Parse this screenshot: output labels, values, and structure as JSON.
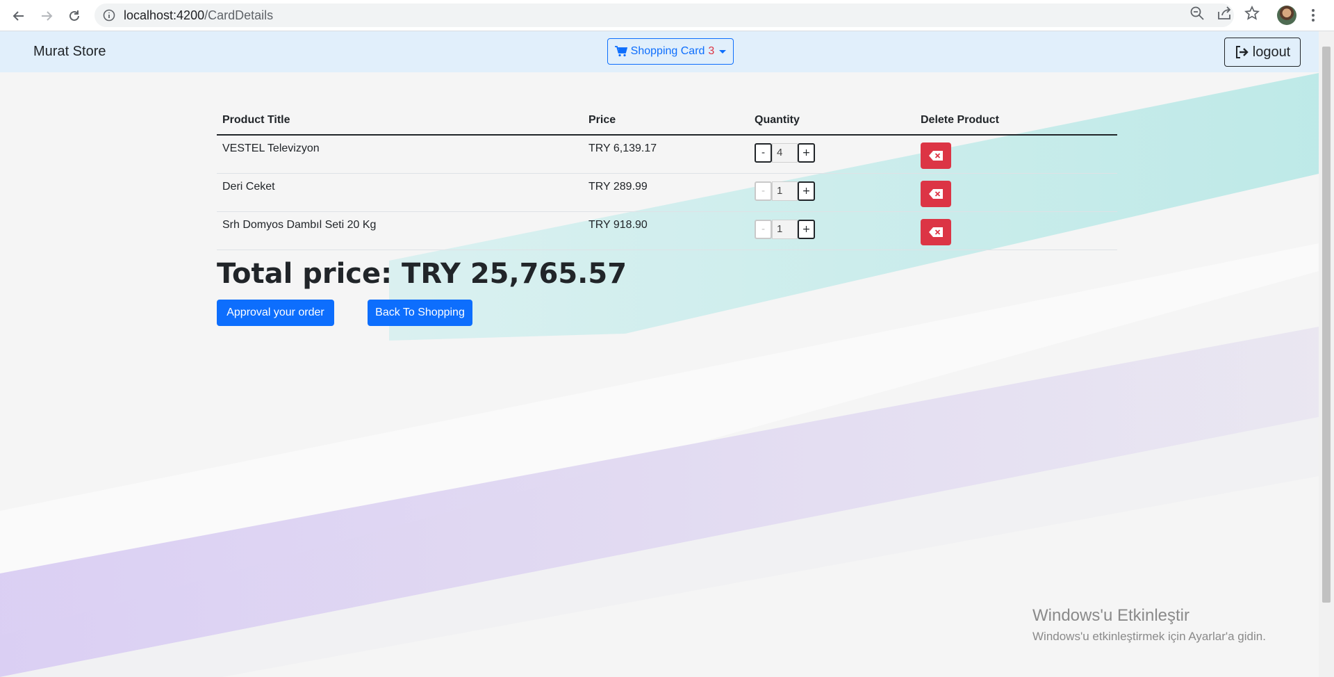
{
  "browser": {
    "url_host": "localhost:4200",
    "url_path": "/CardDetails"
  },
  "navbar": {
    "brand": "Murat Store",
    "cart_label": "Shopping Card",
    "cart_count": "3",
    "logout_label": "logout"
  },
  "table": {
    "headers": [
      "Product Title",
      "Price",
      "Quantity",
      "Delete Product"
    ],
    "rows": [
      {
        "title": "VESTEL Televizyon",
        "price": "TRY 6,139.17",
        "quantity": "4"
      },
      {
        "title": "Deri Ceket",
        "price": "TRY 289.99",
        "quantity": "1"
      },
      {
        "title": "Srh Domyos Dambıl Seti 20 Kg",
        "price": "TRY 918.90",
        "quantity": "1"
      }
    ],
    "minus_label": "-",
    "plus_label": "+"
  },
  "total": "Total price: TRY 25,765.57",
  "buttons": {
    "approve": "Approval your order",
    "back": "Back To Shopping"
  },
  "watermark": {
    "title": "Windows'u Etkinleştir",
    "subtitle": "Windows'u etkinleştirmek için Ayarlar'a gidin."
  },
  "colors": {
    "navbar_bg": "#e1effb",
    "primary": "#0d6efd",
    "danger": "#dc3545"
  },
  "icons": [
    "back-arrow-icon",
    "forward-arrow-icon",
    "reload-icon",
    "info-icon",
    "zoom-icon",
    "share-icon",
    "star-icon",
    "cart-icon",
    "logout-icon",
    "backspace-x-icon"
  ]
}
